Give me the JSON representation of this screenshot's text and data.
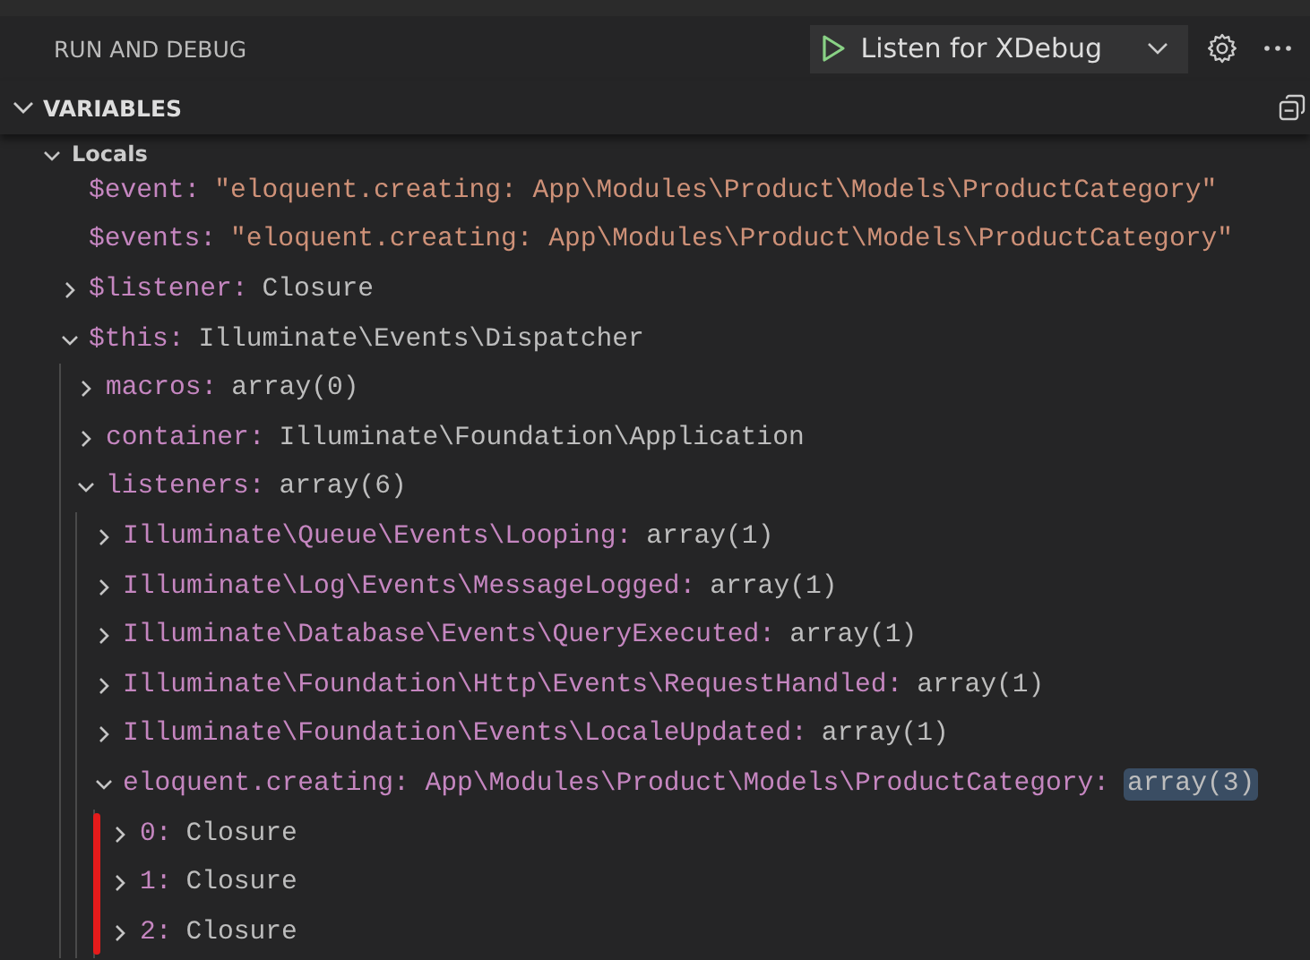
{
  "panel": {
    "title": "RUN AND DEBUG",
    "launch_config": "Listen for XDebug"
  },
  "section": {
    "title": "VARIABLES",
    "expanded": true
  },
  "tree": [
    {
      "name": "Locals",
      "expanded": true,
      "children": [
        {
          "name": "$event:",
          "value": "\"eloquent.creating: App\\Modules\\Product\\Models\\ProductCategory\"",
          "kind": "string"
        },
        {
          "name": "$events:",
          "value": "\"eloquent.creating: App\\Modules\\Product\\Models\\ProductCategory\"",
          "kind": "string"
        },
        {
          "name": "$listener:",
          "value": "Closure",
          "kind": "plain",
          "expanded": false
        },
        {
          "name": "$this:",
          "value": "Illuminate\\Events\\Dispatcher",
          "kind": "plain",
          "expanded": true,
          "children": [
            {
              "name": "macros:",
              "value": "array(0)",
              "kind": "plain",
              "expanded": false
            },
            {
              "name": "container:",
              "value": "Illuminate\\Foundation\\Application",
              "kind": "plain",
              "expanded": false
            },
            {
              "name": "listeners:",
              "value": "array(6)",
              "kind": "plain",
              "expanded": true,
              "children": [
                {
                  "name": "Illuminate\\Queue\\Events\\Looping:",
                  "value": "array(1)",
                  "kind": "plain",
                  "expanded": false
                },
                {
                  "name": "Illuminate\\Log\\Events\\MessageLogged:",
                  "value": "array(1)",
                  "kind": "plain",
                  "expanded": false
                },
                {
                  "name": "Illuminate\\Database\\Events\\QueryExecuted:",
                  "value": "array(1)",
                  "kind": "plain",
                  "expanded": false
                },
                {
                  "name": "Illuminate\\Foundation\\Http\\Events\\RequestHandled:",
                  "value": "array(1)",
                  "kind": "plain",
                  "expanded": false
                },
                {
                  "name": "Illuminate\\Foundation\\Events\\LocaleUpdated:",
                  "value": "array(1)",
                  "kind": "plain",
                  "expanded": false
                },
                {
                  "name": "eloquent.creating: App\\Modules\\Product\\Models\\ProductCategory:",
                  "value": "array(3)",
                  "kind": "plain",
                  "expanded": true,
                  "highlighted": true,
                  "flagged": true,
                  "children": [
                    {
                      "name": "0:",
                      "value": "Closure",
                      "kind": "plain",
                      "expanded": false
                    },
                    {
                      "name": "1:",
                      "value": "Closure",
                      "kind": "plain",
                      "expanded": false
                    },
                    {
                      "name": "2:",
                      "value": "Closure",
                      "kind": "plain",
                      "expanded": false
                    }
                  ]
                }
              ]
            }
          ]
        }
      ]
    }
  ]
}
